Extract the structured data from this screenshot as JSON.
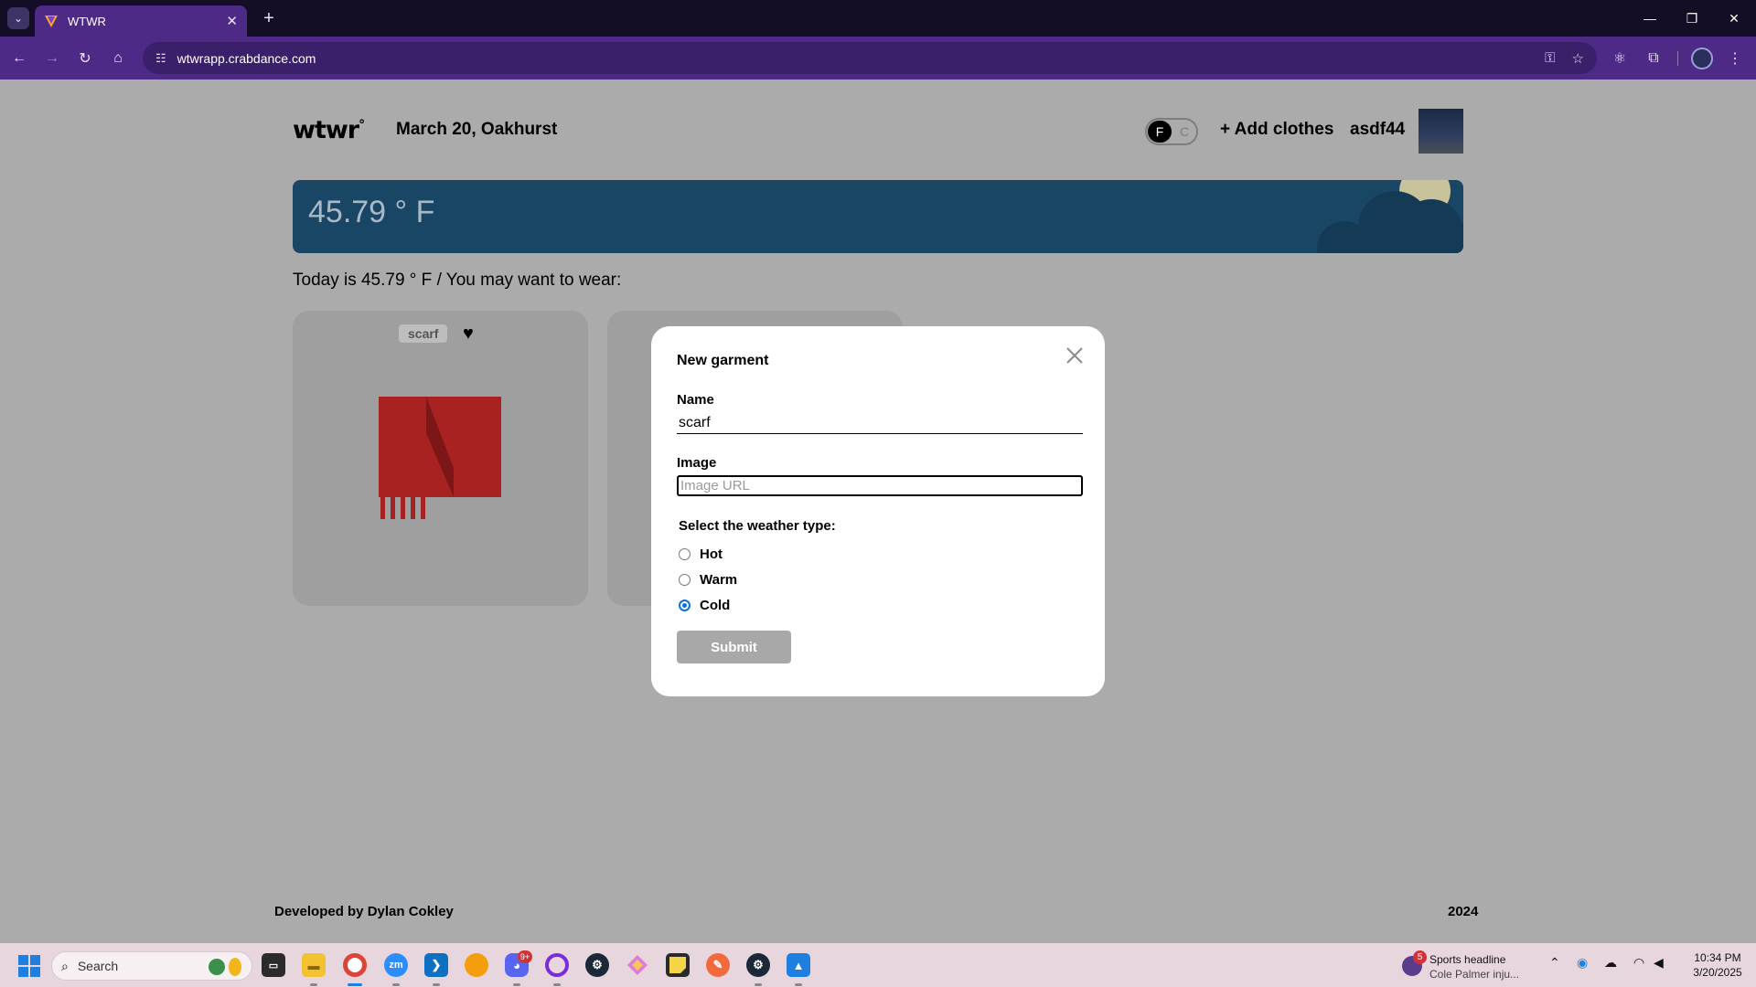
{
  "browser": {
    "tab_title": "WTWR",
    "url": "wtwrapp.crabdance.com"
  },
  "header": {
    "logo_text": "wtwr",
    "logo_mark": "°",
    "date_location": "March 20, Oakhurst",
    "unit_f": "F",
    "unit_c": "C",
    "selected_unit": "F",
    "add_clothes_label": "+ Add clothes",
    "username": "asdf44"
  },
  "weather": {
    "temperature": "45.79 ° F",
    "card_color": "#1a4666"
  },
  "main": {
    "wear_text": "Today is 45.79 ° F / You may want to wear:",
    "items": [
      {
        "name": "scarf",
        "liked": true,
        "icon": "scarf-image"
      },
      {
        "name": "",
        "liked": false,
        "icon": ""
      }
    ]
  },
  "modal": {
    "title": "New garment",
    "name_label": "Name",
    "name_value": "scarf",
    "image_label": "Image",
    "image_placeholder": "Image URL",
    "weather_legend": "Select the weather type:",
    "options": [
      {
        "label": "Hot",
        "checked": false
      },
      {
        "label": "Warm",
        "checked": false
      },
      {
        "label": "Cold",
        "checked": true
      }
    ],
    "submit_label": "Submit"
  },
  "footer": {
    "developer": "Developed by Dylan Cokley",
    "year": "2024"
  },
  "taskbar": {
    "search_label": "Search",
    "news_badge": "5",
    "news_title": "Sports headline",
    "news_subtitle": "Cole Palmer inju...",
    "time": "10:34 PM",
    "date": "3/20/2025",
    "discord_badge": "9+"
  },
  "colors": {
    "accent": "#4c2a86",
    "page_bg": "#ababab",
    "radio_checked": "#0f6fdc"
  }
}
